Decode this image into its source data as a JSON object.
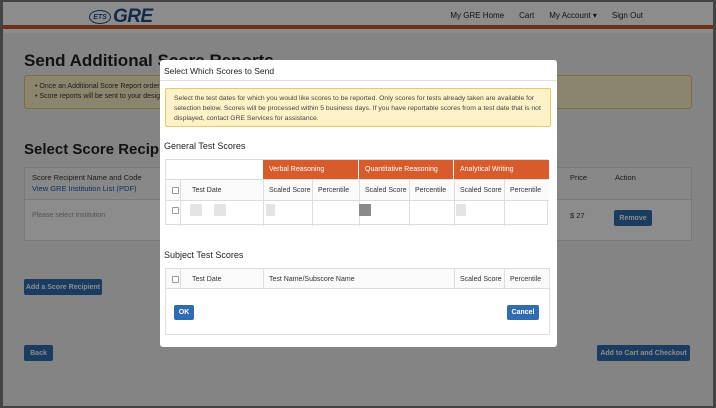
{
  "header": {
    "logo_ets": "ETS",
    "logo_gre": "GRE",
    "nav": [
      "My GRE Home",
      "Cart",
      "My Account ▾",
      "Sign Out"
    ]
  },
  "page": {
    "title": "Send Additional Score Reports",
    "alert_lines": [
      "•  Once an Additional Score Report order",
      "•  Score reports will be sent to your desig"
    ],
    "recipients_title": "Select Score Recipients",
    "table": {
      "col_name": "Score Recipient Name and Code",
      "list_link": "View GRE Institution List (PDF)",
      "col_price": "Price",
      "col_action": "Action",
      "input_placeholder": "Please select institution",
      "price_value": "$ 27",
      "remove_label": "Remove"
    },
    "add_label": "Add a Score Recipient",
    "back_label": "Back",
    "checkout_label": "Add to Cart and Checkout"
  },
  "modal": {
    "title": "Select Which Scores to Send",
    "alert": "Select the test dates for which you would like scores to be reported. Only scores for tests already taken are available for selection below. Scores will be processed within 5 business days. If you have reportable scores from a test date that is not displayed, contact GRE Services for assistance.",
    "general_title": "General Test Scores",
    "groups": [
      "Verbal Reasoning",
      "Quantitative Reasoning",
      "Analytical Writing"
    ],
    "test_date": "Test Date",
    "scaled": "Scaled Score",
    "percentile": "Percentile",
    "subject_title": "Subject Test Scores",
    "subject_cols": [
      "Test Date",
      "Test Name/Subscore Name",
      "Scaled Score",
      "Percentile"
    ],
    "ok_label": "OK",
    "cancel_label": "Cancel"
  },
  "colors": {
    "accent": "#d85b2b",
    "primary": "#2f6db0",
    "alert": "#fdf2c7"
  }
}
